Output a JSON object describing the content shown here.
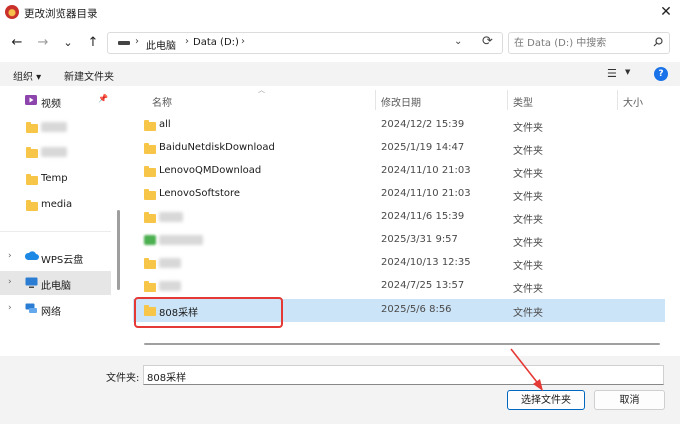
{
  "window": {
    "title": "更改浏览器目录",
    "close_glyph": "✕"
  },
  "nav": {
    "back_glyph": "←",
    "forward_glyph": "→",
    "recent_glyph": "⌄",
    "up_glyph": "↑",
    "breadcrumbs": [
      "此电脑",
      "Data (D:)"
    ],
    "crumb_separator": "›",
    "address_dropdown_glyph": "⌄",
    "refresh_glyph": "⟳",
    "search_placeholder": "在 Data (D:) 中搜索"
  },
  "toolbar": {
    "organize_label": "组织 ▾",
    "new_folder_label": "新建文件夹",
    "view_glyph": "☰",
    "view_dropdown_glyph": "▼",
    "help_glyph": "?"
  },
  "sidebar": {
    "pin_glyph": "📌",
    "expand_glyph": "›",
    "quick_access": [
      {
        "label": "视频",
        "icon": "video-folder-icon"
      },
      {
        "label": "",
        "icon": "folder-icon"
      },
      {
        "label": "",
        "icon": "folder-icon"
      },
      {
        "label": "Temp",
        "icon": "folder-icon"
      },
      {
        "label": "media",
        "icon": "folder-icon"
      }
    ],
    "locations": [
      {
        "label": "WPS云盘",
        "icon": "cloud-icon"
      },
      {
        "label": "此电脑",
        "icon": "computer-icon",
        "selected": true
      },
      {
        "label": "网络",
        "icon": "network-icon"
      }
    ]
  },
  "file_list": {
    "columns": [
      "名称",
      "修改日期",
      "类型",
      "大小"
    ],
    "rows": [
      {
        "name": "all",
        "date": "2024/12/2 15:39",
        "type": "文件夹"
      },
      {
        "name": "BaiduNetdiskDownload",
        "date": "2025/1/19 14:47",
        "type": "文件夹"
      },
      {
        "name": "LenovoQMDownload",
        "date": "2024/11/10 21:03",
        "type": "文件夹"
      },
      {
        "name": "LenovoSoftstore",
        "date": "2024/11/10 21:03",
        "type": "文件夹"
      },
      {
        "name": "",
        "date": "2024/11/6 15:39",
        "type": "文件夹"
      },
      {
        "name": "",
        "date": "2025/3/31 9:57",
        "type": "文件夹"
      },
      {
        "name": "",
        "date": "2024/10/13 12:35",
        "type": "文件夹"
      },
      {
        "name": "",
        "date": "2024/7/25 13:57",
        "type": "文件夹"
      },
      {
        "name": "808采样",
        "date": "2025/5/6 8:56",
        "type": "文件夹",
        "selected": true
      }
    ]
  },
  "footer": {
    "folder_label": "文件夹:",
    "folder_value": "808采样",
    "select_button": "选择文件夹",
    "cancel_button": "取消"
  },
  "colors": {
    "accent": "#0067c0",
    "selection": "#cce4f7",
    "highlight_annotation": "#e53935",
    "folder": "#f7c548"
  }
}
